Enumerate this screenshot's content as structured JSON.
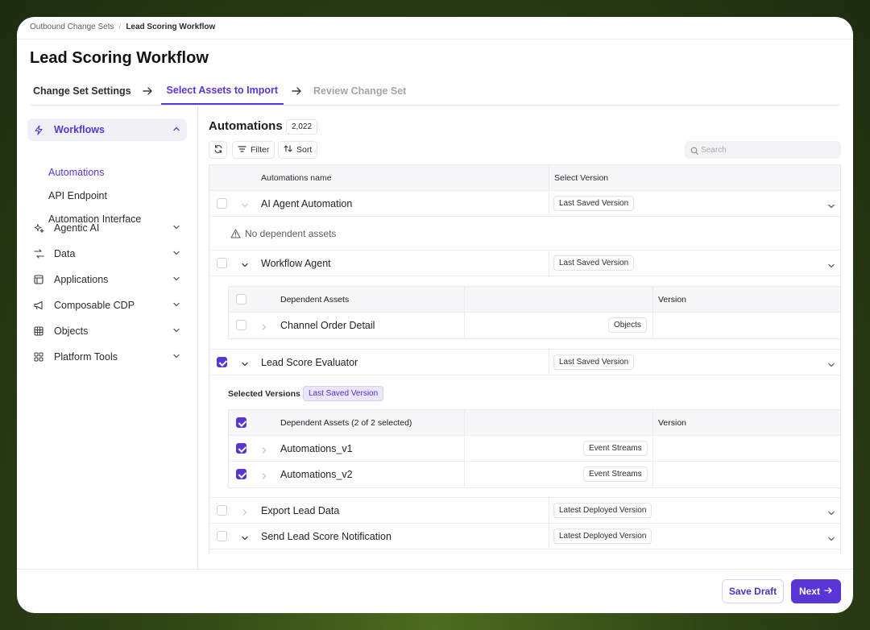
{
  "breadcrumb": {
    "parent": "Outbound Change Sets",
    "sep": "/",
    "current": "Lead Scoring Workflow"
  },
  "page_title": "Lead Scoring Workflow",
  "steps": [
    {
      "label": "Change Set Settings",
      "state": "done"
    },
    {
      "label": "Select Assets to Import",
      "state": "active"
    },
    {
      "label": "Review Change Set",
      "state": "disabled"
    }
  ],
  "sidebar": {
    "items": [
      {
        "label": "Workflows",
        "icon": "bolt-icon"
      },
      {
        "label": "Agentic AI",
        "icon": "sparkle-icon"
      },
      {
        "label": "Data",
        "icon": "data-flow-icon"
      },
      {
        "label": "Applications",
        "icon": "layout-icon"
      },
      {
        "label": "Composable CDP",
        "icon": "megaphone-icon"
      },
      {
        "label": "Objects",
        "icon": "grid-icon"
      },
      {
        "label": "Platform Tools",
        "icon": "apps-icon"
      }
    ],
    "sub_items": [
      "Automations",
      "API Endpoint",
      "Automation Interface"
    ]
  },
  "main": {
    "title": "Automations",
    "count": "2,022",
    "filter_label": "Filter",
    "sort_label": "Sort",
    "search_placeholder": "Search",
    "columns": {
      "name": "Automations name",
      "version": "Select Version"
    },
    "no_dependents": "No dependent assets",
    "rows": [
      {
        "name": "AI Agent Automation",
        "version": "Last Saved Version",
        "checked": false
      },
      {
        "name": "Workflow Agent",
        "version": "Last Saved Version",
        "checked": false
      },
      {
        "name": "Lead Score Evaluator",
        "version": "Last Saved Version",
        "checked": true
      },
      {
        "name": "Export Lead Data",
        "version": "Latest Deployed Version",
        "checked": false
      },
      {
        "name": "Send Lead Score Notification",
        "version": "Latest Deployed Version",
        "checked": false
      }
    ],
    "dep_table_1": {
      "col_assets": "Dependent Assets",
      "col_version": "Version",
      "rows": [
        {
          "name": "Channel Order Detail",
          "type": "Objects"
        }
      ]
    },
    "selected_versions_label": "Selected Versions",
    "selected_versions_value": "Last Saved Version",
    "dep_table_2": {
      "col_assets": "Dependent Assets (2 of 2 selected)",
      "col_version": "Version",
      "rows": [
        {
          "name": "Automations_v1",
          "type": "Event Streams"
        },
        {
          "name": "Automations_v2",
          "type": "Event Streams"
        }
      ]
    }
  },
  "footer": {
    "save_draft": "Save Draft",
    "next": "Next"
  },
  "colors": {
    "accent": "#5a35d6",
    "background": "#2f4416"
  }
}
